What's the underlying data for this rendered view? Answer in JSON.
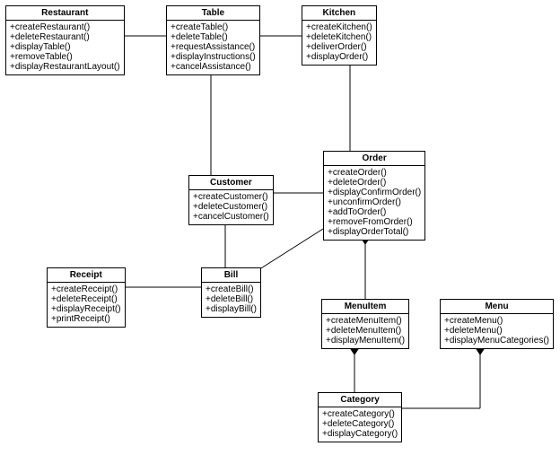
{
  "classes": {
    "restaurant": {
      "title": "Restaurant",
      "methods": [
        "+createRestaurant()",
        "+deleteRestaurant()",
        "+displayTable()",
        "+removeTable()",
        "+displayRestaurantLayout()"
      ]
    },
    "table": {
      "title": "Table",
      "methods": [
        "+createTable()",
        "+deleteTable()",
        "+requestAssistance()",
        "+displayInstructions()",
        "+cancelAssistance()"
      ]
    },
    "kitchen": {
      "title": "Kitchen",
      "methods": [
        "+createKitchen()",
        "+deleteKitchen()",
        "+deliverOrder()",
        "+displayOrder()"
      ]
    },
    "customer": {
      "title": "Customer",
      "methods": [
        "+createCustomer()",
        "+deleteCustomer()",
        "+cancelCustomer()"
      ]
    },
    "order": {
      "title": "Order",
      "methods": [
        "+createOrder()",
        "+deleteOrder()",
        "+displayConfirmOrder()",
        "+unconfirmOrder()",
        "+addToOrder()",
        "+removeFromOrder()",
        "+displayOrderTotal()"
      ]
    },
    "receipt": {
      "title": "Receipt",
      "methods": [
        "+createReceipt()",
        "+deleteReceipt()",
        "+displayReceipt()",
        "+printReceipt()"
      ]
    },
    "bill": {
      "title": "Bill",
      "methods": [
        "+createBill()",
        "+deleteBill()",
        "+displayBill()"
      ]
    },
    "menuitem": {
      "title": "MenuItem",
      "methods": [
        "+createMenuItem()",
        "+deleteMenuItem()",
        "+displayMenuItem()"
      ]
    },
    "menu": {
      "title": "Menu",
      "methods": [
        "+createMenu()",
        "+deleteMenu()",
        "+displayMenuCategories()"
      ]
    },
    "category": {
      "title": "Category",
      "methods": [
        "+createCategory()",
        "+deleteCategory()",
        "+displayCategory()"
      ]
    }
  },
  "chart_data": {
    "type": "uml-class-diagram",
    "classes": [
      {
        "name": "Restaurant",
        "operations": [
          "createRestaurant()",
          "deleteRestaurant()",
          "displayTable()",
          "removeTable()",
          "displayRestaurantLayout()"
        ]
      },
      {
        "name": "Table",
        "operations": [
          "createTable()",
          "deleteTable()",
          "requestAssistance()",
          "displayInstructions()",
          "cancelAssistance()"
        ]
      },
      {
        "name": "Kitchen",
        "operations": [
          "createKitchen()",
          "deleteKitchen()",
          "deliverOrder()",
          "displayOrder()"
        ]
      },
      {
        "name": "Customer",
        "operations": [
          "createCustomer()",
          "deleteCustomer()",
          "cancelCustomer()"
        ]
      },
      {
        "name": "Order",
        "operations": [
          "createOrder()",
          "deleteOrder()",
          "displayConfirmOrder()",
          "unconfirmOrder()",
          "addToOrder()",
          "removeFromOrder()",
          "displayOrderTotal()"
        ]
      },
      {
        "name": "Receipt",
        "operations": [
          "createReceipt()",
          "deleteReceipt()",
          "displayReceipt()",
          "printReceipt()"
        ]
      },
      {
        "name": "Bill",
        "operations": [
          "createBill()",
          "deleteBill()",
          "displayBill()"
        ]
      },
      {
        "name": "MenuItem",
        "operations": [
          "createMenuItem()",
          "deleteMenuItem()",
          "displayMenuItem()"
        ]
      },
      {
        "name": "Menu",
        "operations": [
          "createMenu()",
          "deleteMenu()",
          "displayMenuCategories()"
        ]
      },
      {
        "name": "Category",
        "operations": [
          "createCategory()",
          "deleteCategory()",
          "displayCategory()"
        ]
      }
    ],
    "relationships": [
      {
        "from": "Restaurant",
        "to": "Table",
        "type": "aggregation",
        "diamondAt": "Restaurant"
      },
      {
        "from": "Table",
        "to": "Kitchen",
        "type": "association"
      },
      {
        "from": "Table",
        "to": "Customer",
        "type": "association"
      },
      {
        "from": "Customer",
        "to": "Order",
        "type": "association"
      },
      {
        "from": "Kitchen",
        "to": "Order",
        "type": "association"
      },
      {
        "from": "Order",
        "to": "MenuItem",
        "type": "composition",
        "diamondAt": "Order"
      },
      {
        "from": "Customer",
        "to": "Bill",
        "type": "association"
      },
      {
        "from": "Bill",
        "to": "Receipt",
        "type": "association"
      },
      {
        "from": "Bill",
        "to": "Order",
        "type": "association"
      },
      {
        "from": "MenuItem",
        "to": "Category",
        "type": "composition",
        "diamondAt": "MenuItem"
      },
      {
        "from": "Menu",
        "to": "Category",
        "type": "composition",
        "diamondAt": "Menu"
      }
    ]
  }
}
